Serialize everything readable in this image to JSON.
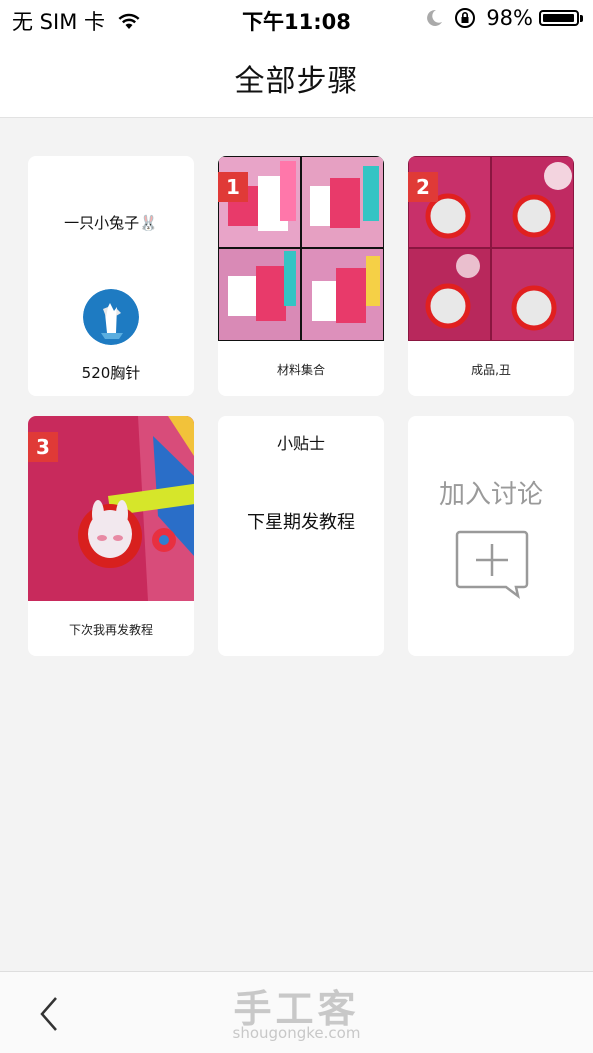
{
  "status_bar": {
    "carrier": "无 SIM 卡",
    "time": "下午11:08",
    "battery_percent": "98%",
    "battery_level": 0.98,
    "icons": [
      "wifi-icon",
      "moon-icon",
      "rotation-lock-icon",
      "battery-icon"
    ]
  },
  "header": {
    "title": "全部步骤"
  },
  "cover": {
    "author": "一只小兔子🐰",
    "project_title": "520胸针"
  },
  "steps": [
    {
      "number": "1",
      "caption": "材料集合"
    },
    {
      "number": "2",
      "caption": "成品,丑"
    },
    {
      "number": "3",
      "caption": "下次我再发教程"
    }
  ],
  "tip": {
    "title": "小贴士",
    "body": "下星期发教程"
  },
  "join": {
    "label": "加入讨论",
    "icon": "add-comment-icon"
  },
  "bottom_bar": {
    "back_icon": "chevron-left-icon",
    "brand_cn": "手工客",
    "brand_en": "shougongke.com"
  },
  "colors": {
    "accent": "#e03a37",
    "background": "#f3f3f3",
    "muted": "#9a9a9a"
  }
}
